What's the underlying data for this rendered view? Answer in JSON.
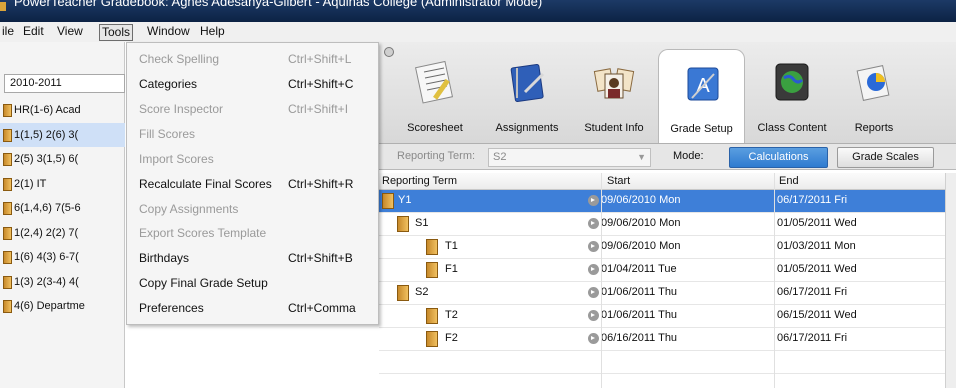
{
  "window": {
    "title": "PowerTeacher Gradebook: Agnes Adesanya-Gilbert - Aquinas College (Administrator Mode)"
  },
  "menubar": {
    "items": [
      "ile",
      "Edit",
      "View",
      "Tools",
      "Window",
      "Help"
    ],
    "open_item": "Tools"
  },
  "left_panel": {
    "term": "2010-2011",
    "classes": [
      {
        "label": "HR(1-6) Acad",
        "selected": false
      },
      {
        "label": "1(1,5) 2(6) 3(",
        "selected": true
      },
      {
        "label": "2(5) 3(1,5) 6(",
        "selected": false
      },
      {
        "label": "2(1) IT",
        "selected": false
      },
      {
        "label": "6(1,4,6) 7(5-6",
        "selected": false
      },
      {
        "label": "1(2,4) 2(2) 7(",
        "selected": false
      },
      {
        "label": "1(6) 4(3) 6-7(",
        "selected": false
      },
      {
        "label": "1(3) 2(3-4) 4(",
        "selected": false
      },
      {
        "label": "4(6) Departme",
        "selected": false
      }
    ]
  },
  "tools_menu": {
    "items": [
      {
        "label": "Check Spelling",
        "shortcut": "Ctrl+Shift+L",
        "enabled": false
      },
      {
        "label": "Categories",
        "shortcut": "Ctrl+Shift+C",
        "enabled": true
      },
      {
        "label": "Score Inspector",
        "shortcut": "Ctrl+Shift+I",
        "enabled": false
      },
      {
        "label": "Fill Scores",
        "shortcut": "",
        "enabled": false
      },
      {
        "label": "Import Scores",
        "shortcut": "",
        "enabled": false
      },
      {
        "label": "Recalculate Final Scores",
        "shortcut": "Ctrl+Shift+R",
        "enabled": true
      },
      {
        "label": "Copy Assignments",
        "shortcut": "",
        "enabled": false
      },
      {
        "label": "Export Scores Template",
        "shortcut": "",
        "enabled": false
      },
      {
        "label": "Birthdays",
        "shortcut": "Ctrl+Shift+B",
        "enabled": true
      },
      {
        "label": "Copy Final Grade Setup",
        "shortcut": "",
        "enabled": true
      },
      {
        "label": "Preferences",
        "shortcut": "Ctrl+Comma",
        "enabled": true
      }
    ]
  },
  "toolbar": {
    "buttons": [
      {
        "label": "Scoresheet",
        "icon": "scoresheet-icon",
        "active": false
      },
      {
        "label": "Assignments",
        "icon": "assignments-icon",
        "active": false
      },
      {
        "label": "Student Info",
        "icon": "student-info-icon",
        "active": false
      },
      {
        "label": "Grade Setup",
        "icon": "grade-setup-icon",
        "active": true
      },
      {
        "label": "Class Content",
        "icon": "class-content-icon",
        "active": false
      },
      {
        "label": "Reports",
        "icon": "reports-icon",
        "active": false
      }
    ]
  },
  "subbar": {
    "reporting_term_label": "Reporting Term:",
    "reporting_term_value": "S2",
    "mode_label": "Mode:",
    "calculations_label": "Calculations",
    "grade_scales_label": "Grade Scales"
  },
  "table": {
    "headers": [
      "Reporting Term",
      "Start",
      "End"
    ],
    "rows": [
      {
        "term": "Y1",
        "level": 0,
        "start": "09/06/2010 Mon",
        "end": "06/17/2011 Fri",
        "selected": true
      },
      {
        "term": "S1",
        "level": 1,
        "start": "09/06/2010 Mon",
        "end": "01/05/2011 Wed",
        "selected": false
      },
      {
        "term": "T1",
        "level": 2,
        "start": "09/06/2010 Mon",
        "end": "01/03/2011 Mon",
        "selected": false
      },
      {
        "term": "F1",
        "level": 2,
        "start": "01/04/2011 Tue",
        "end": "01/05/2011 Wed",
        "selected": false
      },
      {
        "term": "S2",
        "level": 1,
        "start": "01/06/2011 Thu",
        "end": "06/17/2011 Fri",
        "selected": false
      },
      {
        "term": "T2",
        "level": 2,
        "start": "01/06/2011 Thu",
        "end": "06/15/2011 Wed",
        "selected": false
      },
      {
        "term": "F2",
        "level": 2,
        "start": "06/16/2011 Thu",
        "end": "06/17/2011 Fri",
        "selected": false
      }
    ]
  },
  "colors": {
    "selection": "#3e7fd8",
    "calc_button": "#2f7bd0",
    "folder": "#d9a43a"
  }
}
